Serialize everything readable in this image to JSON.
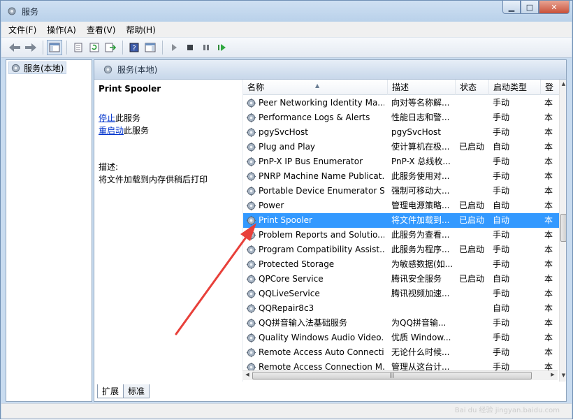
{
  "window": {
    "title": "服务"
  },
  "menu": [
    "文件(F)",
    "操作(A)",
    "查看(V)",
    "帮助(H)"
  ],
  "tree": {
    "root": "服务(本地)"
  },
  "panel": {
    "header": "服务(本地)",
    "selected_service": "Print Spooler",
    "stop_link": "停止",
    "stop_suffix": "此服务",
    "restart_link": "重启动",
    "restart_suffix": "此服务",
    "desc_label": "描述:",
    "desc_text": "将文件加载到内存供稍后打印"
  },
  "columns": {
    "name": "名称",
    "desc": "描述",
    "status": "状态",
    "startup": "启动类型",
    "logon": "登"
  },
  "services": [
    {
      "name": "Peer Networking Identity Ma...",
      "desc": "向对等名称解...",
      "status": "",
      "startup": "手动",
      "logon": "本"
    },
    {
      "name": "Performance Logs & Alerts",
      "desc": "性能日志和警...",
      "status": "",
      "startup": "手动",
      "logon": "本"
    },
    {
      "name": "pgySvcHost",
      "desc": "pgySvcHost",
      "status": "",
      "startup": "手动",
      "logon": "本"
    },
    {
      "name": "Plug and Play",
      "desc": "使计算机在极...",
      "status": "已启动",
      "startup": "自动",
      "logon": "本"
    },
    {
      "name": "PnP-X IP Bus Enumerator",
      "desc": "PnP-X 总线枚...",
      "status": "",
      "startup": "手动",
      "logon": "本"
    },
    {
      "name": "PNRP Machine Name Publicat...",
      "desc": "此服务使用对...",
      "status": "",
      "startup": "手动",
      "logon": "本"
    },
    {
      "name": "Portable Device Enumerator S...",
      "desc": "强制可移动大...",
      "status": "",
      "startup": "手动",
      "logon": "本"
    },
    {
      "name": "Power",
      "desc": "管理电源策略...",
      "status": "已启动",
      "startup": "自动",
      "logon": "本"
    },
    {
      "name": "Print Spooler",
      "desc": "将文件加载到...",
      "status": "已启动",
      "startup": "自动",
      "logon": "本",
      "selected": true
    },
    {
      "name": "Problem Reports and Solutio...",
      "desc": "此服务为查看...",
      "status": "",
      "startup": "手动",
      "logon": "本"
    },
    {
      "name": "Program Compatibility Assist...",
      "desc": "此服务为程序...",
      "status": "已启动",
      "startup": "手动",
      "logon": "本"
    },
    {
      "name": "Protected Storage",
      "desc": "为敏感数据(如...",
      "status": "",
      "startup": "手动",
      "logon": "本"
    },
    {
      "name": "QPCore Service",
      "desc": "腾讯安全服务",
      "status": "已启动",
      "startup": "自动",
      "logon": "本"
    },
    {
      "name": "QQLiveService",
      "desc": "腾讯视频加速...",
      "status": "",
      "startup": "手动",
      "logon": "本"
    },
    {
      "name": "QQRepair8c3",
      "desc": "",
      "status": "",
      "startup": "自动",
      "logon": "本"
    },
    {
      "name": "QQ拼音输入法基础服务",
      "desc": "为QQ拼音输...",
      "status": "",
      "startup": "手动",
      "logon": "本"
    },
    {
      "name": "Quality Windows Audio Video...",
      "desc": "优质 Window...",
      "status": "",
      "startup": "手动",
      "logon": "本"
    },
    {
      "name": "Remote Access Auto Connecti...",
      "desc": "无论什么时候...",
      "status": "",
      "startup": "手动",
      "logon": "本"
    },
    {
      "name": "Remote Access Connection M...",
      "desc": "管理从这台计...",
      "status": "",
      "startup": "手动",
      "logon": "本"
    }
  ],
  "tabs": [
    "扩展",
    "标准"
  ],
  "colors": {
    "selection": "#3399ff",
    "link": "#0033cc",
    "arrow": "#e8403a"
  },
  "watermark": "Bai du 经验 jingyan.baidu.com"
}
